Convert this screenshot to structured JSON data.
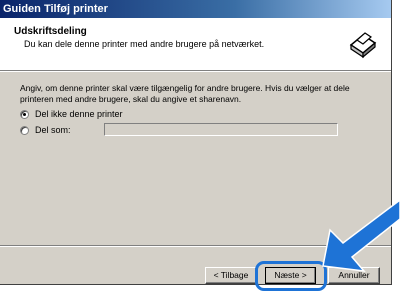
{
  "window": {
    "title": "Guiden Tilføj printer"
  },
  "header": {
    "title": "Udskriftsdeling",
    "subtitle": "Du kan dele denne printer med andre brugere på netværket."
  },
  "body": {
    "description": "Angiv, om denne printer skal være tilgængelig for andre brugere. Hvis du vælger at dele printeren med andre brugere, skal du angive et sharenavn.",
    "options": [
      {
        "label": "Del ikke denne printer",
        "selected": true
      },
      {
        "label": "Del som:",
        "selected": false
      }
    ],
    "share_name": ""
  },
  "buttons": {
    "back": "< Tilbage",
    "next": "Næste >",
    "cancel": "Annuller"
  },
  "colors": {
    "highlight": "#1e73d6",
    "arrow": "#1e73d6"
  }
}
